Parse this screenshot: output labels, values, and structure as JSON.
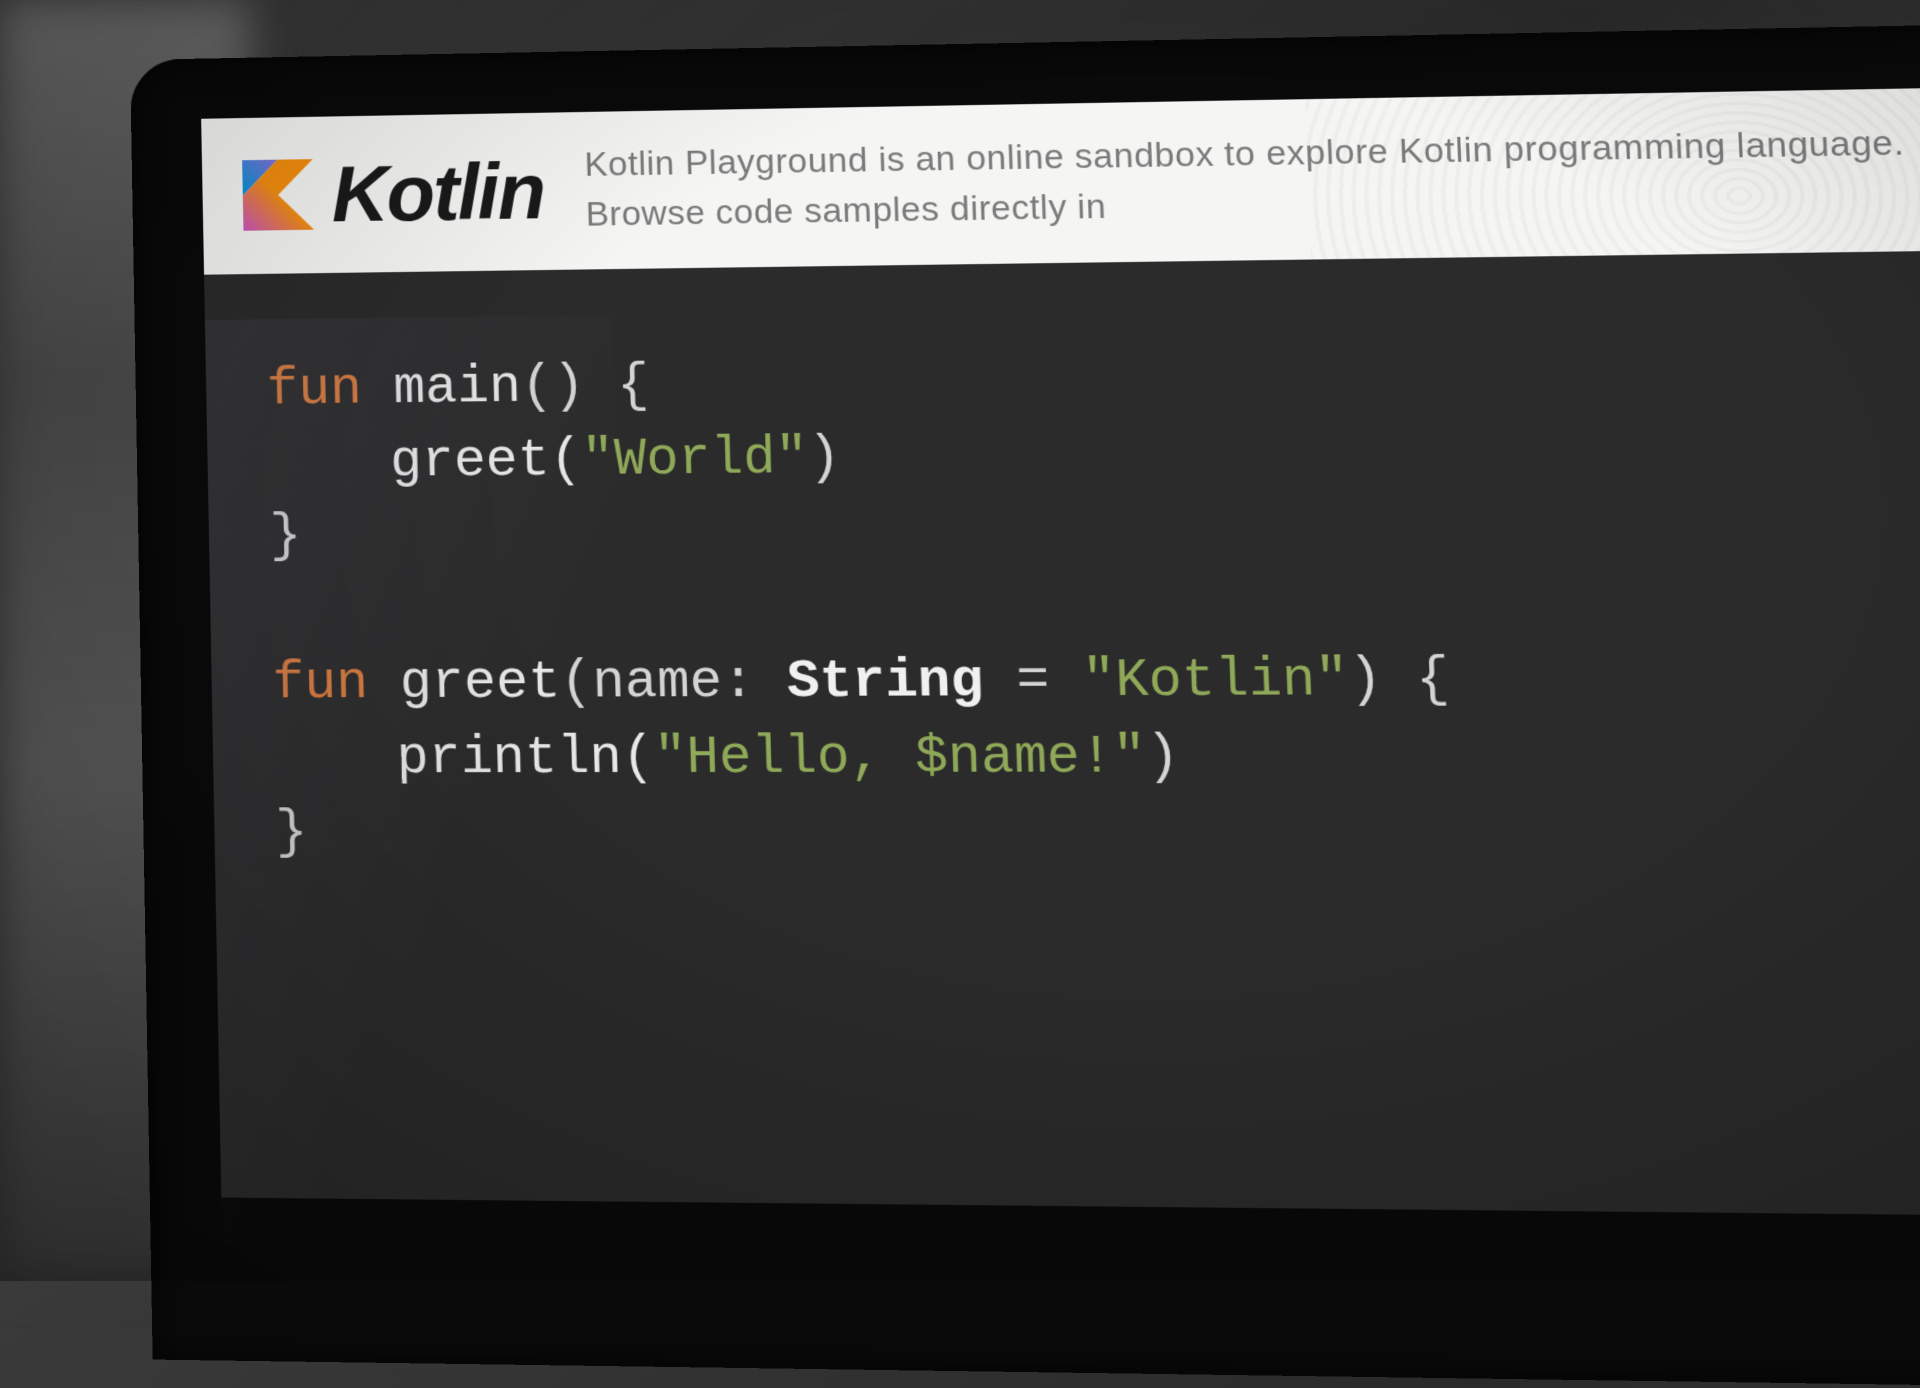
{
  "header": {
    "brand": "Kotlin",
    "description": "Kotlin Playground is an online sandbox to explore Kotlin programming language. Browse code samples directly in"
  },
  "editor": {
    "lines": [
      {
        "tokens": [
          {
            "t": "fun ",
            "cls": "kw"
          },
          {
            "t": "main",
            "cls": "fn"
          },
          {
            "t": "() {",
            "cls": "punct"
          }
        ]
      },
      {
        "indent": true,
        "tokens": [
          {
            "t": "greet(",
            "cls": "fn"
          },
          {
            "t": "\"World\"",
            "cls": "str"
          },
          {
            "t": ")",
            "cls": "punct"
          }
        ]
      },
      {
        "tokens": [
          {
            "t": "}",
            "cls": "punct"
          }
        ]
      },
      {
        "tokens": [
          {
            "t": " ",
            "cls": "punct"
          }
        ]
      },
      {
        "tokens": [
          {
            "t": "fun ",
            "cls": "kw"
          },
          {
            "t": "greet",
            "cls": "fn"
          },
          {
            "t": "(name: ",
            "cls": "param"
          },
          {
            "t": "String",
            "cls": "type"
          },
          {
            "t": " = ",
            "cls": "op"
          },
          {
            "t": "\"Kotlin\"",
            "cls": "str"
          },
          {
            "t": ") {",
            "cls": "punct"
          }
        ]
      },
      {
        "indent": true,
        "tokens": [
          {
            "t": "println(",
            "cls": "fn"
          },
          {
            "t": "\"Hello, $name!\"",
            "cls": "str"
          },
          {
            "t": ")",
            "cls": "punct"
          }
        ]
      },
      {
        "tokens": [
          {
            "t": "}",
            "cls": "punct"
          }
        ]
      }
    ]
  },
  "colors": {
    "keyword": "#d87b3e",
    "string": "#8fa959",
    "editor_bg": "#2b2b2b",
    "header_bg": "#f5f5f3"
  }
}
